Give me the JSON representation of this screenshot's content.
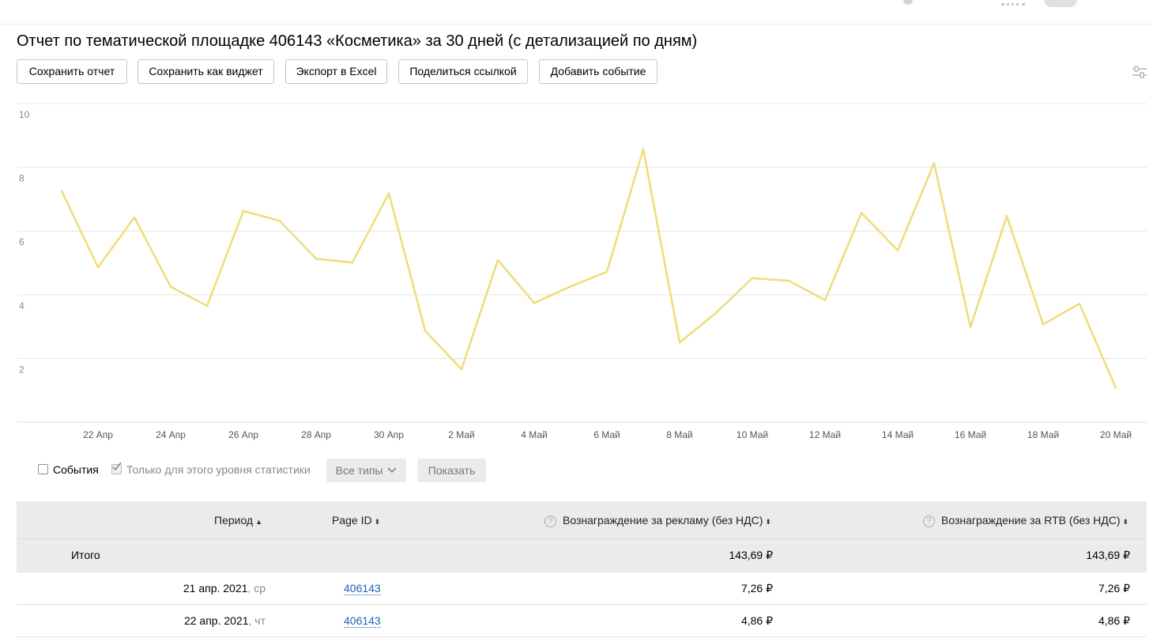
{
  "page": {
    "title": "Отчет по тематической площадке 406143 «Косметика» за 30 дней (с детализацией по дням)"
  },
  "toolbar": {
    "buttons": [
      "Сохранить отчет",
      "Сохранить как виджет",
      "Экспорт в Excel",
      "Поделиться ссылкой",
      "Добавить событие"
    ]
  },
  "icons": {
    "settings": "sliders-icon",
    "question": "question-icon",
    "checkmark": "check-icon",
    "chevron": "chevron-down-icon"
  },
  "chart_data": {
    "type": "line",
    "title": "",
    "xlabel": "",
    "ylabel": "",
    "ylim": [
      0,
      10
    ],
    "yticks": [
      2,
      4,
      6,
      8,
      10
    ],
    "grid": true,
    "line_color": "#f0dc78",
    "x": [
      "21 Апр",
      "22 Апр",
      "23 Апр",
      "24 Апр",
      "25 Апр",
      "26 Апр",
      "27 Апр",
      "28 Апр",
      "29 Апр",
      "30 Апр",
      "1 Май",
      "2 Май",
      "3 Май",
      "4 Май",
      "5 Май",
      "6 Май",
      "7 Май",
      "8 Май",
      "9 Май",
      "10 Май",
      "11 Май",
      "12 Май",
      "13 Май",
      "14 Май",
      "15 Май",
      "16 Май",
      "17 Май",
      "18 Май",
      "19 Май",
      "20 Май"
    ],
    "xtick_labels": [
      "22 Апр",
      "24 Апр",
      "26 Апр",
      "28 Апр",
      "30 Апр",
      "2 Май",
      "4 Май",
      "6 Май",
      "8 Май",
      "10 Май",
      "12 Май",
      "14 Май",
      "16 Май",
      "18 Май",
      "20 Май"
    ],
    "series": [
      {
        "values": [
          7.26,
          4.86,
          6.43,
          4.25,
          3.65,
          6.63,
          6.32,
          5.13,
          5.01,
          7.18,
          2.87,
          1.66,
          5.09,
          3.74,
          4.26,
          4.72,
          8.57,
          2.5,
          3.43,
          4.52,
          4.44,
          3.83,
          6.57,
          5.39,
          8.13,
          2.98,
          6.47,
          3.07,
          3.72,
          1.07
        ]
      }
    ]
  },
  "filters": {
    "events_label": "События",
    "events_checked": false,
    "level_only_label": "Только для этого уровня статистики",
    "level_only_checked": true,
    "types_select": "Все типы",
    "show_button": "Показать"
  },
  "table": {
    "columns": {
      "period": "Период",
      "page_id": "Page ID",
      "ad_reward": "Вознаграждение за рекламу (без НДС)",
      "rtb_reward": "Вознаграждение за RTB (без НДС)"
    },
    "total": {
      "label": "Итого",
      "ad_reward": "143,69 ₽",
      "rtb_reward": "143,69 ₽"
    },
    "rows": [
      {
        "date": "21 апр. 2021",
        "weekday": ", ср",
        "page_id": "406143",
        "ad_reward": "7,26 ₽",
        "rtb_reward": "7,26 ₽"
      },
      {
        "date": "22 апр. 2021",
        "weekday": ", чт",
        "page_id": "406143",
        "ad_reward": "4,86 ₽",
        "rtb_reward": "4,86 ₽"
      }
    ]
  }
}
